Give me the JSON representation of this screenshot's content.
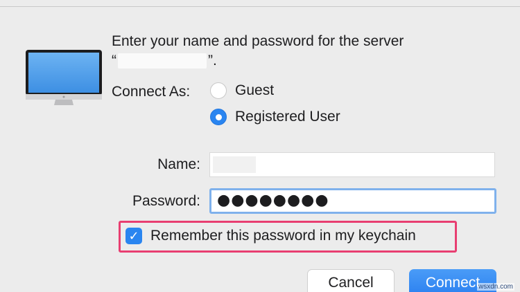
{
  "dialog": {
    "prompt_line1": "Enter your name and password for the server",
    "prompt_open_quote": "“",
    "prompt_close_quote": "”."
  },
  "connect_as": {
    "label": "Connect As:",
    "options": [
      {
        "label": "Guest",
        "selected": false
      },
      {
        "label": "Registered User",
        "selected": true
      }
    ]
  },
  "fields": {
    "name_label": "Name:",
    "password_label": "Password:",
    "password_mask": "●●●●●●●●"
  },
  "keychain": {
    "label": "Remember this password in my keychain",
    "checked": true,
    "check_glyph": "✓"
  },
  "buttons": {
    "cancel": "Cancel",
    "connect": "Connect"
  },
  "watermark": "wsxdn.com",
  "colors": {
    "accent": "#2a85f0",
    "highlight": "#e83e71",
    "focus_ring": "#7fb1ec"
  }
}
